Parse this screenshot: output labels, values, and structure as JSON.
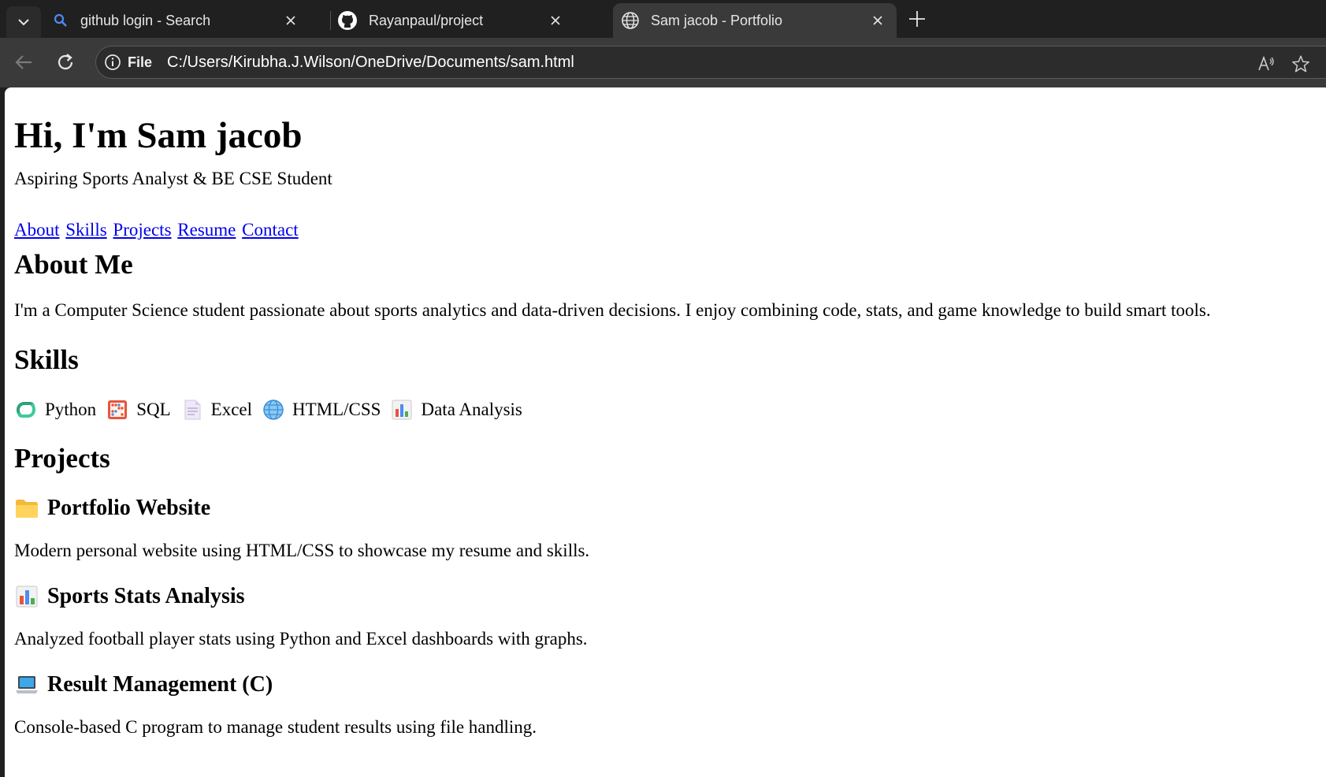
{
  "browser": {
    "tabs": [
      {
        "title": "github login - Search",
        "icon": "search-icon",
        "active": false
      },
      {
        "title": "Rayanpaul/project",
        "icon": "github-icon",
        "active": false
      },
      {
        "title": "Sam jacob - Portfolio",
        "icon": "globe-icon",
        "active": true
      }
    ],
    "address_bar": {
      "site_label": "File",
      "url": "C:/Users/Kirubha.J.Wilson/OneDrive/Documents/sam.html"
    },
    "colors": {
      "tabstrip": "#202020",
      "toolbar": "#3a3a3a",
      "active_tab": "#3a3a3a"
    }
  },
  "page": {
    "heading": "Hi, I'm Sam jacob",
    "tagline": "Aspiring Sports Analyst & BE CSE Student",
    "nav": [
      "About",
      "Skills",
      "Projects",
      "Resume",
      "Contact"
    ],
    "about": {
      "heading": "About Me",
      "text": "I'm a Computer Science student passionate about sports analytics and data-driven decisions. I enjoy combining code, stats, and game knowledge to build smart tools."
    },
    "skills": {
      "heading": "Skills",
      "items": [
        {
          "label": "Python",
          "icon": "python-icon"
        },
        {
          "label": "SQL",
          "icon": "abacus-icon"
        },
        {
          "label": "Excel",
          "icon": "document-icon"
        },
        {
          "label": "HTML/CSS",
          "icon": "globe-icon"
        },
        {
          "label": "Data Analysis",
          "icon": "bar-chart-icon"
        }
      ]
    },
    "projects": {
      "heading": "Projects",
      "items": [
        {
          "title": "Portfolio Website",
          "icon": "folder-icon",
          "desc": "Modern personal website using HTML/CSS to showcase my resume and skills."
        },
        {
          "title": "Sports Stats Analysis",
          "icon": "bar-chart-icon",
          "desc": "Analyzed football player stats using Python and Excel dashboards with graphs."
        },
        {
          "title": "Result Management (C)",
          "icon": "laptop-icon",
          "desc": "Console-based C program to manage student results using file handling."
        }
      ]
    },
    "link_color": "#0000ee"
  }
}
